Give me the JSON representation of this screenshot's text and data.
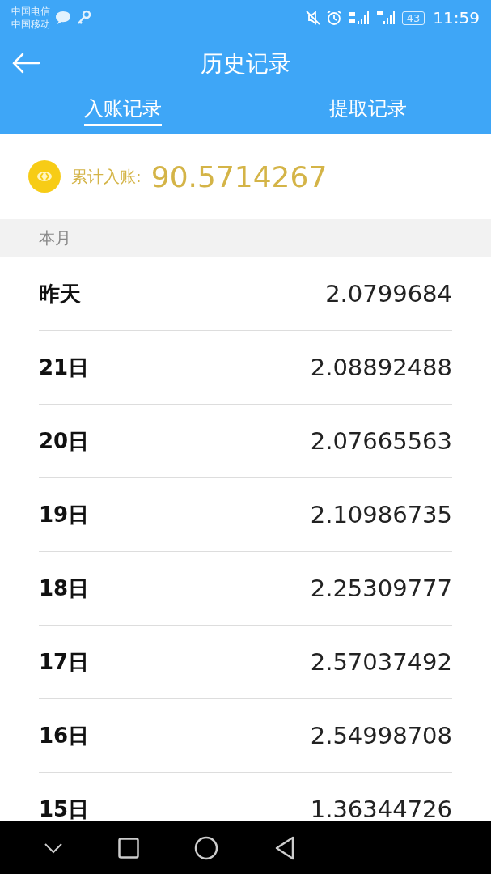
{
  "status_bar": {
    "carriers": [
      "中国电信",
      "中国移动"
    ],
    "battery": "43",
    "time": "11:59"
  },
  "header": {
    "title": "历史记录"
  },
  "tabs": [
    {
      "label": "入账记录",
      "selected": true
    },
    {
      "label": "提取记录",
      "selected": false
    }
  ],
  "summary": {
    "label": "累计入账:",
    "amount": "90.5714267"
  },
  "section": {
    "title": "本月"
  },
  "rows": [
    {
      "day": "昨天",
      "amount": "2.0799684"
    },
    {
      "day": "21日",
      "amount": "2.08892488"
    },
    {
      "day": "20日",
      "amount": "2.07665563"
    },
    {
      "day": "19日",
      "amount": "2.10986735"
    },
    {
      "day": "18日",
      "amount": "2.25309777"
    },
    {
      "day": "17日",
      "amount": "2.57037492"
    },
    {
      "day": "16日",
      "amount": "2.54998708"
    },
    {
      "day": "15日",
      "amount": "1.36344726"
    }
  ]
}
